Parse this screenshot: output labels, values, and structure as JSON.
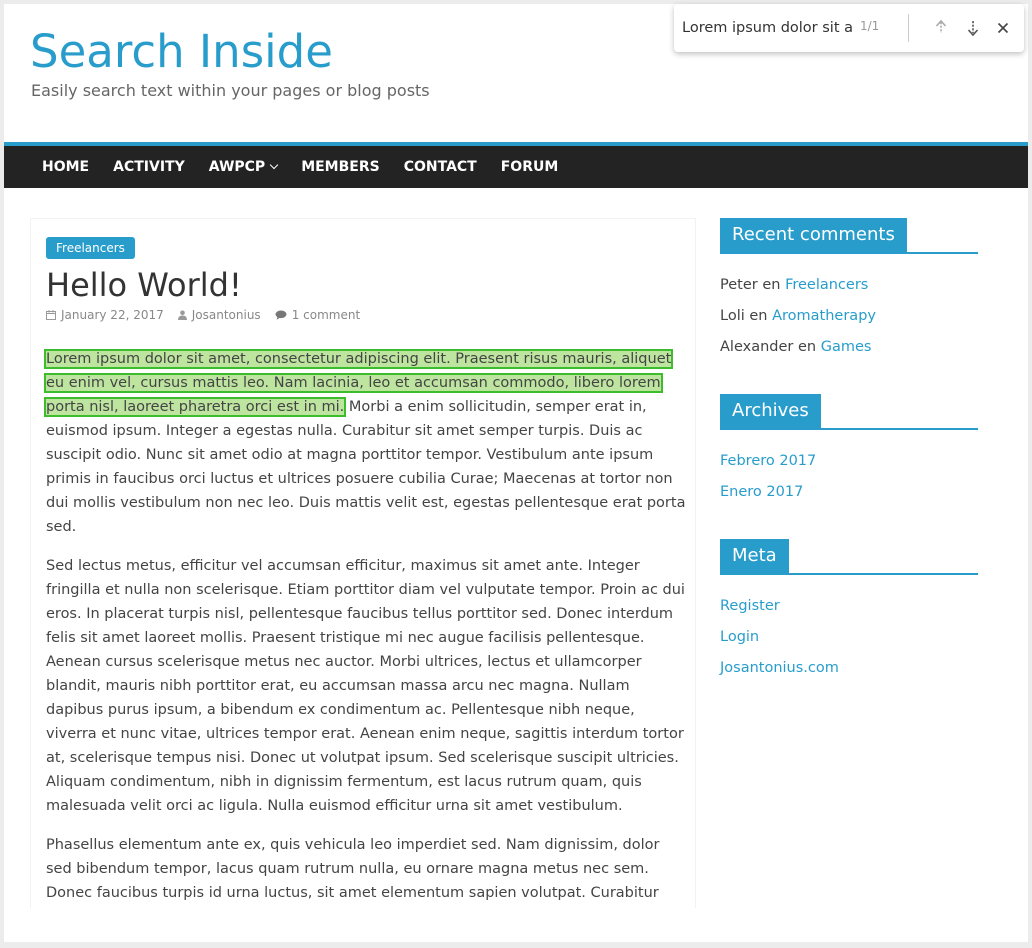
{
  "header": {
    "title": "Search Inside",
    "description": "Easily search text within your pages or blog posts"
  },
  "nav": {
    "items": [
      {
        "label": "HOME"
      },
      {
        "label": "ACTIVITY"
      },
      {
        "label": "AWPCP"
      },
      {
        "label": "MEMBERS"
      },
      {
        "label": "CONTACT"
      },
      {
        "label": "FORUM"
      }
    ]
  },
  "post": {
    "category": "Freelancers",
    "title": "Hello World!",
    "date": "January 22, 2017",
    "author": "Josantonius",
    "comments": "1 comment",
    "highlighted": "Lorem ipsum dolor sit amet, consectetur adipiscing elit. Praesent risus mauris, aliquet eu enim vel, cursus mattis leo. Nam lacinia, leo et accumsan commodo, libero lorem porta nisl, laoreet pharetra orci est in mi.",
    "p1_rest": " Morbi a enim sollicitudin, semper erat in, euismod ipsum. Integer a egestas nulla. Curabitur sit amet semper turpis. Duis ac suscipit odio. Nunc sit amet odio at magna porttitor tempor. Vestibulum ante ipsum primis in faucibus orci luctus et ultrices posuere cubilia Curae; Maecenas at tortor non dui mollis vestibulum non nec leo. Duis mattis velit est, egestas pellentesque erat porta sed.",
    "p2": "Sed lectus metus, efficitur vel accumsan efficitur, maximus sit amet ante. Integer fringilla et nulla non scelerisque. Etiam porttitor diam vel vulputate tempor. Proin ac dui eros. In placerat turpis nisl, pellentesque faucibus tellus porttitor sed. Donec interdum felis sit amet laoreet mollis. Praesent tristique mi nec augue facilisis pellentesque. Aenean cursus scelerisque metus nec auctor. Morbi ultrices, lectus et ullamcorper blandit, mauris nibh porttitor erat, eu accumsan massa arcu nec magna. Nullam dapibus purus ipsum, a bibendum ex condimentum ac. Pellentesque nibh neque, viverra et nunc vitae, ultrices tempor erat. Aenean enim neque, sagittis interdum tortor at, scelerisque tempus nisi. Donec ut volutpat ipsum. Sed scelerisque suscipit ultricies. Aliquam condimentum, nibh in dignissim fermentum, est lacus rutrum quam, quis malesuada velit orci ac ligula. Nulla euismod efficitur urna sit amet vestibulum.",
    "p3": "Phasellus elementum ante ex, quis vehicula leo imperdiet sed. Nam dignissim, dolor sed bibendum tempor, lacus quam rutrum nulla, eu ornare magna metus nec sem. Donec faucibus turpis id urna luctus, sit amet elementum sapien volutpat. Curabitur sed cursus tortor. Nam sollicitudin, sem sed lacinia pulvinar, magna felis sodales enim, vitae sagittis"
  },
  "sidebar": {
    "recent_comments": {
      "title": "Recent comments",
      "items": [
        {
          "author": "Peter",
          "sep": " en ",
          "link": "Freelancers"
        },
        {
          "author": "Loli",
          "sep": " en ",
          "link": "Aromatherapy"
        },
        {
          "author": "Alexander",
          "sep": " en ",
          "link": "Games"
        }
      ]
    },
    "archives": {
      "title": "Archives",
      "items": [
        {
          "label": "Febrero 2017"
        },
        {
          "label": "Enero 2017"
        }
      ]
    },
    "meta": {
      "title": "Meta",
      "items": [
        {
          "label": "Register"
        },
        {
          "label": "Login"
        },
        {
          "label": "Josantonius.com"
        }
      ]
    }
  },
  "findbar": {
    "query": "Lorem ipsum dolor sit ar",
    "count": "1/1"
  },
  "colors": {
    "accent": "#289dcc",
    "nav_bg": "#232323",
    "highlight": "#bde5a0",
    "highlight_border": "#3dbd2c"
  }
}
